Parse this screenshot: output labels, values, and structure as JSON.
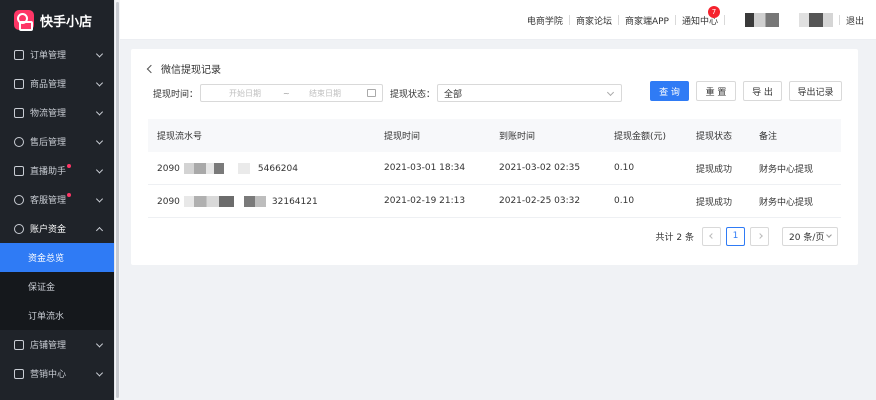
{
  "app": {
    "name": "快手小店"
  },
  "sidebar": {
    "items": [
      {
        "label": "订单管理"
      },
      {
        "label": "商品管理"
      },
      {
        "label": "物流管理"
      },
      {
        "label": "售后管理"
      },
      {
        "label": "直播助手"
      },
      {
        "label": "客服管理"
      },
      {
        "label": "账户资金"
      },
      {
        "label": "资金总览"
      },
      {
        "label": "保证金"
      },
      {
        "label": "订单流水"
      },
      {
        "label": "店铺管理"
      },
      {
        "label": "营销中心"
      }
    ]
  },
  "header": {
    "links": [
      "电商学院",
      "商家论坛",
      "商家端APP",
      "通知中心"
    ],
    "notify_count": "7",
    "logout": "退出"
  },
  "page": {
    "title": "微信提现记录",
    "filter": {
      "time_label": "提现时间：",
      "start_placeholder": "开始日期",
      "separator": "~",
      "end_placeholder": "结束日期",
      "status_label": "提现状态：",
      "status_value": "全部"
    },
    "buttons": {
      "query": "查 询",
      "reset": "重 置",
      "export": "导 出",
      "export_records": "导出记录"
    },
    "table": {
      "columns": [
        "提现流水号",
        "提现时间",
        "到账时间",
        "提现金额(元)",
        "提现状态",
        "备注"
      ],
      "rows": [
        {
          "serial_prefix": "2090",
          "serial_suffix": "5466204",
          "withdraw_time": "2021-03-01 18:34",
          "arrival_time": "2021-03-02 02:35",
          "amount": "0.10",
          "status": "提现成功",
          "note": "财务中心提现"
        },
        {
          "serial_prefix": "2090",
          "serial_suffix": "32164121",
          "withdraw_time": "2021-02-19 21:13",
          "arrival_time": "2021-02-25 03:32",
          "amount": "0.10",
          "status": "提现成功",
          "note": "财务中心提现"
        }
      ]
    },
    "pagination": {
      "total": "共计 2 条",
      "current": "1",
      "page_size": "20 条/页"
    }
  }
}
